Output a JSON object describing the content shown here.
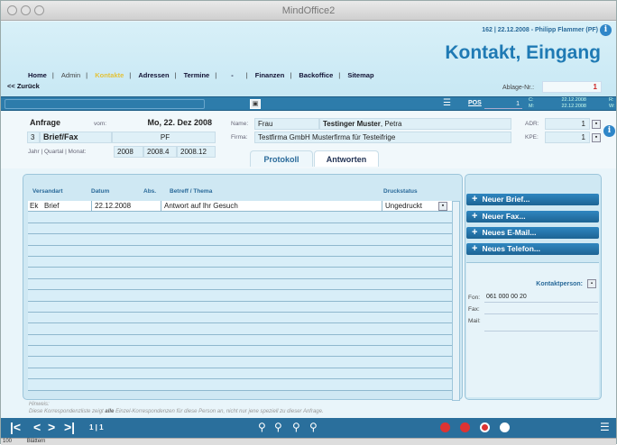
{
  "window": {
    "title": "MindOffice2"
  },
  "header": {
    "user_info": "162 | 22.12.2008 - Philipp Flammer (PF)",
    "page_title": "Kontakt, Eingang",
    "back_label": "<< Zurück",
    "ablage_label": "Ablage-Nr.:",
    "ablage_value": "1"
  },
  "nav": {
    "items": [
      {
        "label": "Home"
      },
      {
        "label": "Admin"
      },
      {
        "label": "Kontakte"
      },
      {
        "label": "Adressen"
      },
      {
        "label": "Termine"
      },
      {
        "label": "-"
      },
      {
        "label": "Finanzen"
      },
      {
        "label": "Backoffice"
      },
      {
        "label": "Sitemap"
      }
    ]
  },
  "toolbar": {
    "pos_label": "POS",
    "record_value": "1",
    "c_label": "C:",
    "m_label": "M:",
    "created": "22.12.2008",
    "modified": "22.12.2008",
    "r_label": "R:",
    "w_label": "W:"
  },
  "form": {
    "type_value": "Anfrage",
    "vom_label": "vom:",
    "date_value": "Mo, 22. Dez 2008",
    "num_value": "3",
    "channel_value": "Brief/Fax",
    "user_value": "PF",
    "period_label": "Jahr | Quartal | Monat:",
    "year": "2008",
    "quarter": "2008.4",
    "month": "2008.12",
    "name_label": "Name:",
    "salutation": "Frau",
    "name_bold": "Testinger Muster",
    "name_rest": ", Petra",
    "firma_label": "Firma:",
    "firma_value": "Testfirma GmbH Musterfirma für Testeifrige",
    "adr_label": "ADR:",
    "adr_value": "1",
    "kpe_label": "KPE:",
    "kpe_value": "1"
  },
  "tabs": [
    {
      "label": "Protokoll"
    },
    {
      "label": "Antworten"
    }
  ],
  "table": {
    "headers": [
      "Versandart",
      "Datum",
      "Abs.",
      "Betreff / Thema",
      "Druckstatus"
    ],
    "rows": [
      {
        "flag": "Ek",
        "type": "Brief",
        "date": "22.12.2008",
        "abs": "",
        "subject": "Antwort auf Ihr Gesuch",
        "status": "Ungedruckt"
      }
    ]
  },
  "actions": {
    "new_letter": "Neuer Brief...",
    "new_fax": "Neuer Fax...",
    "new_email": "Neues E-Mail...",
    "new_phone": "Neues Telefon..."
  },
  "contact": {
    "label": "Kontaktperson:",
    "fon_label": "Fon:",
    "fon_value": "061 000 00 20",
    "fax_label": "Fax:",
    "mail_label": "Mail:"
  },
  "hint": {
    "title": "Hinweis:",
    "text_before": "Diese Korrespondenzliste zeigt ",
    "text_bold": "alle",
    "text_after": " Einzel-Korrespondenzen für diese Person an, nicht nur jene speziell zu dieser Anfrage."
  },
  "bottom": {
    "record_nav": "1 | 1"
  },
  "status": {
    "zoom": "100",
    "mode": "Blättern"
  }
}
